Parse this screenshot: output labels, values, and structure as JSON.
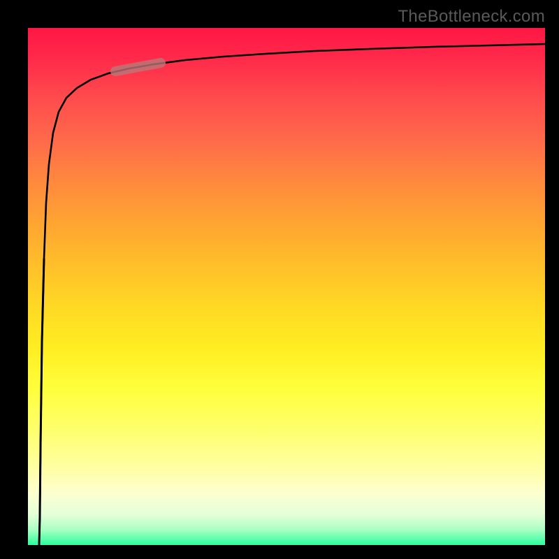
{
  "watermark": "TheBottleneck.com",
  "chart_data": {
    "type": "line",
    "title": "",
    "xlabel": "",
    "ylabel": "",
    "xlim": [
      0,
      100
    ],
    "ylim": [
      0,
      100
    ],
    "x": [
      0,
      0.5,
      1,
      1.5,
      2,
      2.5,
      3,
      4,
      5,
      6,
      8,
      10,
      12,
      15,
      18,
      22,
      26,
      30,
      35,
      40,
      50,
      60,
      70,
      80,
      90,
      100
    ],
    "values": [
      0,
      5,
      20,
      40,
      55,
      65,
      72,
      80,
      84,
      86.5,
      89,
      90.5,
      91.5,
      92.5,
      93.2,
      94,
      94.5,
      94.9,
      95.3,
      95.6,
      96.1,
      96.5,
      96.8,
      97.0,
      97.2,
      97.4
    ],
    "highlight_segment": {
      "x_start": 18,
      "x_end": 25,
      "approx_y": 91
    },
    "gradient_background": {
      "top_color": "#ff1744",
      "bottom_color": "#2cff9e"
    }
  }
}
